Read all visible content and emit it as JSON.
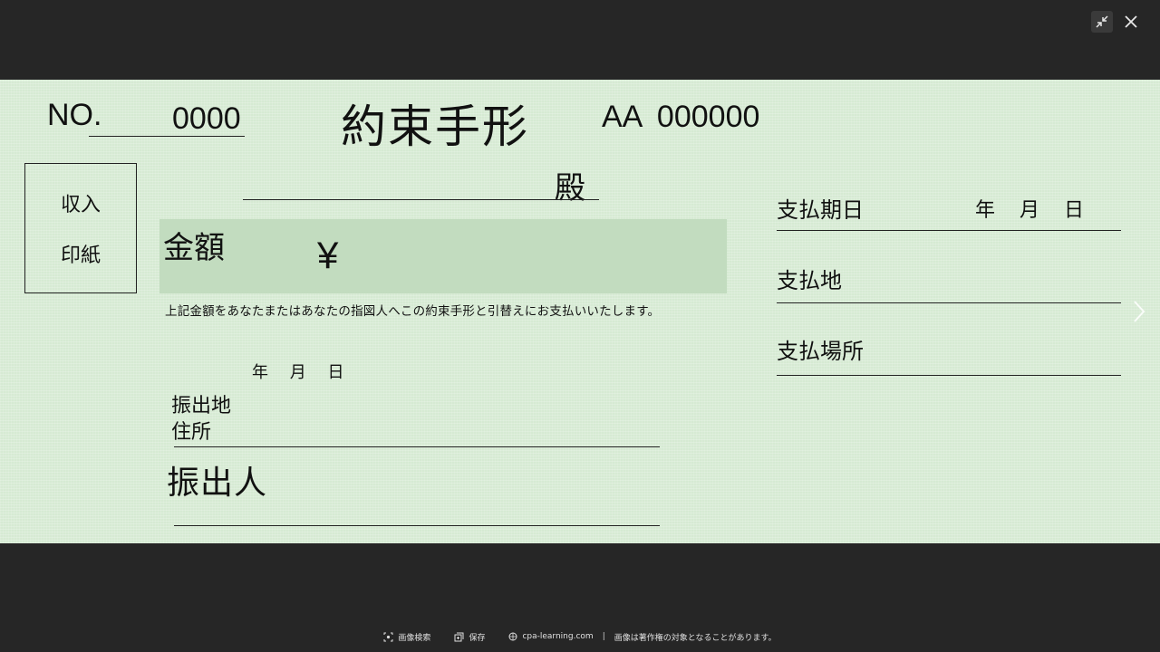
{
  "check": {
    "no_label": "NO.",
    "no_value": "0000",
    "title": "約束手形",
    "serial": "AA 000000",
    "stamp_line1": "収入",
    "stamp_line2": "印紙",
    "dono": "殿",
    "amount_label": "金額",
    "yen_symbol": "¥",
    "notice": "上記金額をあなたまたはあなたの指図人へこの約束手形と引替えにお支払いいたします。",
    "issue_date": "年 月 日",
    "issue_place_line1": "振出地",
    "issue_place_line2": "住所",
    "drawer_label": "振出人",
    "pay_date_label": "支払期日",
    "pay_date_ymd": "年 月 日",
    "pay_place_label": "支払地",
    "pay_location_label": "支払場所"
  },
  "footer": {
    "image_search": "画像検索",
    "save": "保存",
    "source": "cpa-learning.com",
    "separator": "|",
    "copyright": "画像は著作権の対象となることがあります。"
  },
  "icons": {
    "shrink": "shrink-icon",
    "close": "close-icon",
    "next": "chevron-right-icon"
  }
}
